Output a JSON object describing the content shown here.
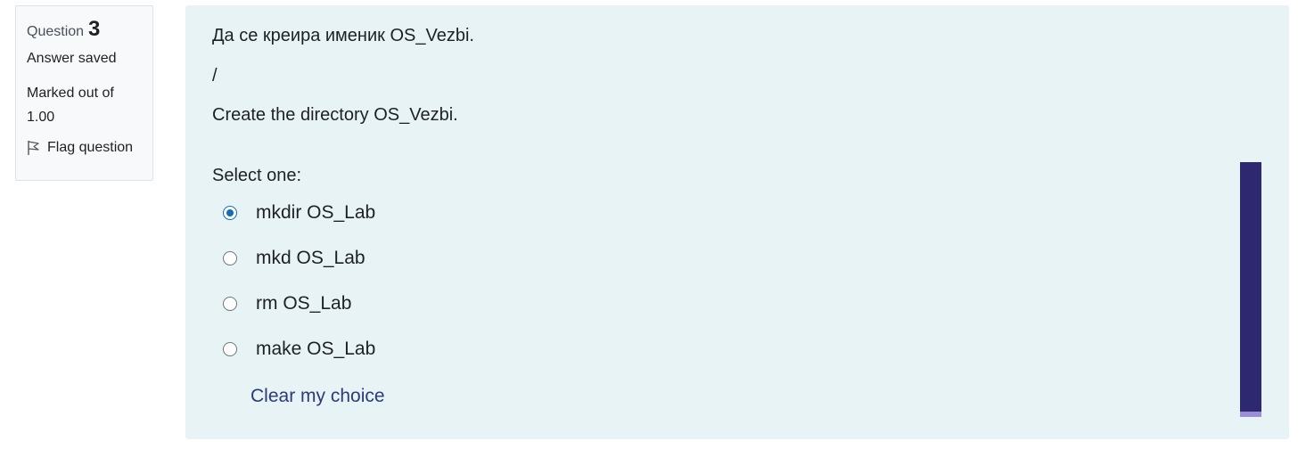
{
  "info": {
    "question_label": "Question",
    "question_number": "3",
    "state": "Answer saved",
    "grade_line1": "Marked out of",
    "grade_line2": "1.00",
    "flag_label": "Flag question"
  },
  "question": {
    "text_mk": "Да се креира именик OS_Vezbi.",
    "separator": "/",
    "text_en": "Create the directory OS_Vezbi.",
    "prompt": "Select one:",
    "options": [
      {
        "label": "mkdir OS_Lab",
        "selected": true
      },
      {
        "label": "mkd OS_Lab",
        "selected": false
      },
      {
        "label": "rm OS_Lab",
        "selected": false
      },
      {
        "label": "make OS_Lab",
        "selected": false
      }
    ],
    "clear_label": "Clear my choice"
  },
  "colors": {
    "accent": "#0f6cbf",
    "content_bg": "#e7f3f5",
    "link": "#2c3a7a",
    "scroll_thumb": "#2e2870"
  },
  "icons": {
    "flag": "flag-icon"
  }
}
